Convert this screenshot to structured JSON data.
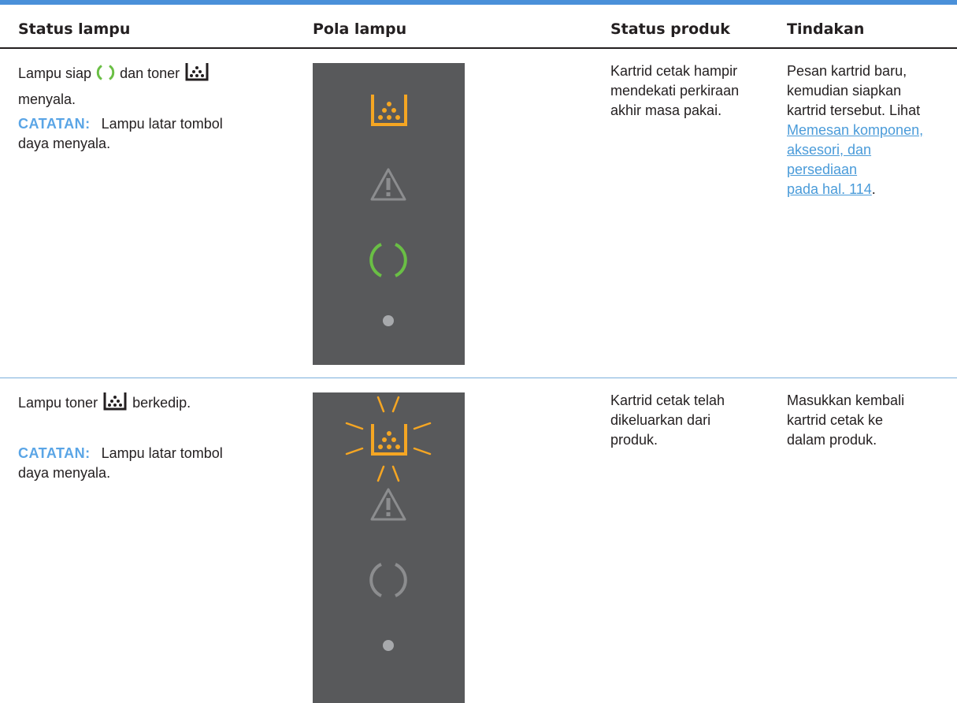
{
  "header": {
    "col1": "Status lampu",
    "col2": "Pola lampu",
    "col3": "Status produk",
    "col4": "Tindakan"
  },
  "rows": [
    {
      "status_pre": "Lampu siap",
      "status_mid": "dan toner",
      "status_post": "menyala.",
      "note_label": "CATATAN:",
      "note_text_1": "Lampu latar tombol",
      "note_text_2": "daya menyala.",
      "product_lines": [
        "Kartrid cetak hampir",
        "mendekati perkiraan",
        "akhir masa pakai."
      ],
      "action_lines": [
        "Pesan kartrid baru,",
        "kemudian siapkan",
        "kartrid tersebut. Lihat"
      ],
      "action_link_lines": [
        "Memesan komponen,",
        "aksesori, dan",
        "persediaan",
        "pada hal. 114"
      ],
      "action_end": ".",
      "lights": {
        "toner": "on",
        "attention": "off",
        "ready": "on",
        "power": "off"
      }
    },
    {
      "status_pre": "Lampu toner",
      "status_mid": "berkedip.",
      "note_label": "CATATAN:",
      "note_text_1": "Lampu latar tombol",
      "note_text_2": "daya menyala.",
      "product_lines": [
        "Kartrid cetak telah",
        "dikeluarkan dari",
        "produk."
      ],
      "action_lines": [
        "Masukkan kembali",
        "kartrid cetak ke",
        "dalam produk."
      ],
      "lights": {
        "toner": "blinking",
        "attention": "off",
        "ready": "off",
        "power": "off"
      }
    }
  ],
  "colors": {
    "accent_blue": "#4a90d9",
    "note_blue": "#5aa5e6",
    "panel_gray": "#58595b",
    "toner_orange": "#f5a623",
    "ready_green": "#6abf45",
    "off_gray": "#8c8d8f"
  },
  "icons": [
    "toner-icon",
    "ready-icon",
    "attention-icon",
    "power-dot-icon",
    "blink-rays-icon"
  ]
}
